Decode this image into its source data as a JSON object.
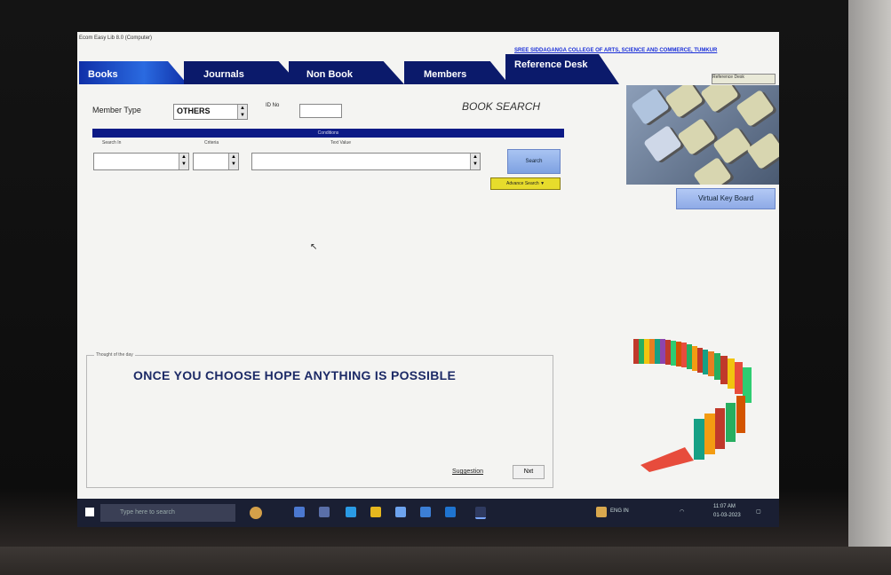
{
  "window": {
    "title": "Ecom Easy Lib 8.0 (Computer)"
  },
  "college": {
    "name": "SREE SIDDAGANGA COLLEGE OF ARTS, SCIENCE AND COMMERCE, TUMKUR"
  },
  "tabs": [
    {
      "label": "Books",
      "active": true
    },
    {
      "label": "Journals",
      "active": false
    },
    {
      "label": "Non Book",
      "active": false
    },
    {
      "label": "Members",
      "active": false
    },
    {
      "label": "Reference Desk",
      "active": false
    }
  ],
  "tab_selector": {
    "value": "Reference Desk"
  },
  "search": {
    "heading": "BOOK SEARCH",
    "member_type_label": "Member Type",
    "member_type_value": "OTHERS",
    "id_label": "ID No",
    "id_value": "",
    "conditions_bar": "Conditions",
    "field_labels": {
      "search_in": "Search In",
      "criteria": "Criteria",
      "text": "Text Value"
    },
    "search_button": "Search",
    "advanced_button": "Advance Search ▼"
  },
  "keyboard": {
    "button": "Virtual Key Board",
    "image_icon": "keyboard-photo"
  },
  "quote": {
    "box_label": "Thought of the day",
    "text": "ONCE YOU CHOOSE HOPE ANYTHING IS POSSIBLE",
    "suggestion_button": "Suggestion",
    "next_button": "Nxt"
  },
  "taskbar": {
    "search_placeholder": "Type here to search",
    "clock_time": "11:07 AM",
    "clock_date": "01-03-2023",
    "tray_label": "ENG IN"
  }
}
